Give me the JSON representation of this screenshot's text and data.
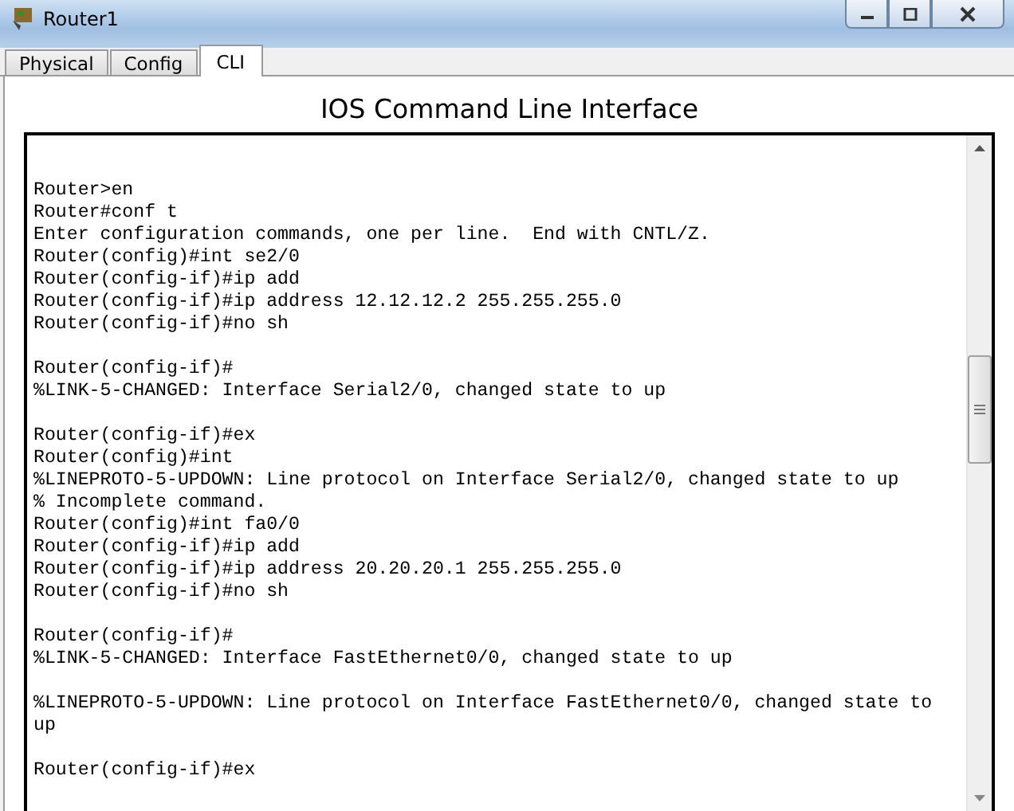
{
  "window": {
    "title": "Router1"
  },
  "tabs": [
    {
      "label": "Physical",
      "selected": false
    },
    {
      "label": "Config",
      "selected": false
    },
    {
      "label": "CLI",
      "selected": true
    }
  ],
  "heading": "IOS Command Line Interface",
  "terminal": {
    "blocks": [
      [
        "Router>en",
        "Router#conf t",
        "Enter configuration commands, one per line.  End with CNTL/Z.",
        "Router(config)#int se2/0",
        "Router(config-if)#ip add",
        "Router(config-if)#ip address 12.12.12.2 255.255.255.0",
        "Router(config-if)#no sh"
      ],
      [
        "Router(config-if)#",
        "%LINK-5-CHANGED: Interface Serial2/0, changed state to up"
      ],
      [
        "Router(config-if)#ex",
        "Router(config)#int",
        "%LINEPROTO-5-UPDOWN: Line protocol on Interface Serial2/0, changed state to up",
        "% Incomplete command.",
        "Router(config)#int fa0/0",
        "Router(config-if)#ip add",
        "Router(config-if)#ip address 20.20.20.1 255.255.255.0",
        "Router(config-if)#no sh"
      ],
      [
        "Router(config-if)#",
        "%LINK-5-CHANGED: Interface FastEthernet0/0, changed state to up"
      ],
      [
        "%LINEPROTO-5-UPDOWN: Line protocol on Interface FastEthernet0/0, changed state to",
        "up"
      ],
      [
        "Router(config-if)#ex"
      ]
    ]
  }
}
